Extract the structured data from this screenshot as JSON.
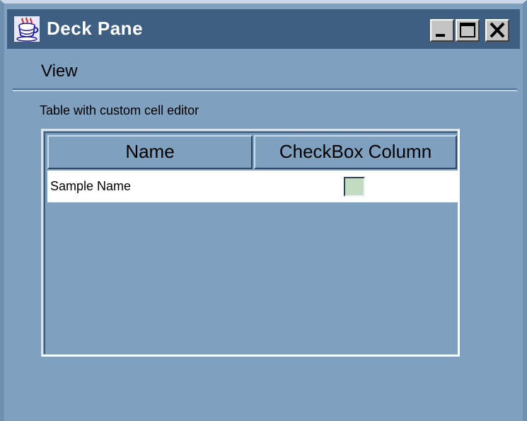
{
  "window": {
    "title": "Deck Pane",
    "icon": "java-coffee-cup-icon",
    "controls": {
      "minimize": "minimize-icon",
      "maximize": "maximize-icon",
      "close": "close-icon"
    }
  },
  "menubar": {
    "items": [
      {
        "label": "View"
      }
    ]
  },
  "content": {
    "caption": "Table with custom cell editor",
    "table": {
      "columns": [
        "Name",
        "CheckBox Column"
      ],
      "rows": [
        {
          "name": "Sample Name",
          "checked": false
        }
      ]
    }
  },
  "colors": {
    "window_background": "#80a0c0",
    "titlebar": "#3e5f82",
    "row_background": "#ffffff",
    "checkbox_fill": "#c4dcc4"
  }
}
